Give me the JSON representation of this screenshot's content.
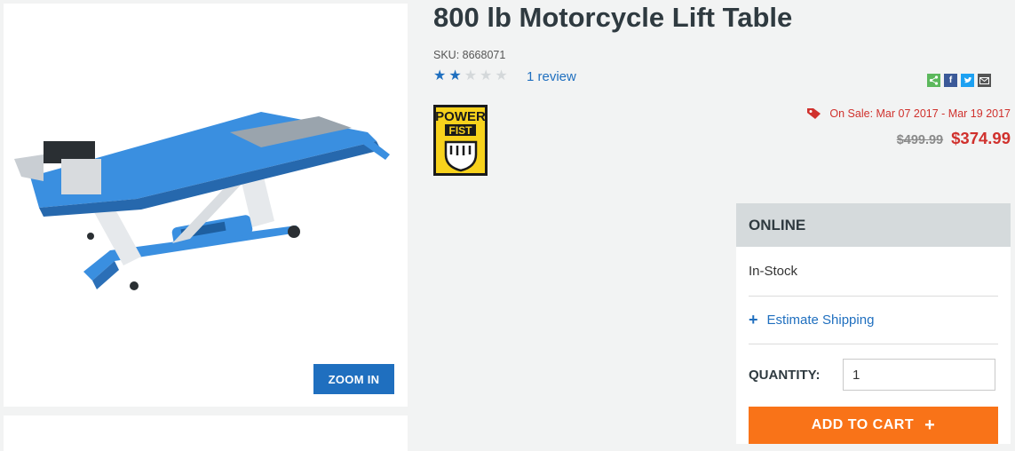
{
  "product": {
    "title": "800 lb Motorcycle Lift Table",
    "sku": "SKU: 8668071",
    "rating": 2,
    "rating_max": 5,
    "review_link": "1 review",
    "brand_logo_text": [
      "POWER",
      "FIST"
    ]
  },
  "gallery": {
    "zoom_label": "ZOOM IN"
  },
  "share": {
    "icons": [
      "share-icon",
      "facebook-icon",
      "twitter-icon",
      "email-icon"
    ],
    "colors": [
      "#5cb85c",
      "#3b5998",
      "#1da1f2",
      "#555555"
    ]
  },
  "pricing": {
    "sale_text": "On Sale: Mar 07 2017 - Mar 19 2017",
    "old_price": "$499.99",
    "new_price": "$374.99"
  },
  "availability": {
    "header": "ONLINE",
    "stock": "In-Stock",
    "estimate_shipping": "Estimate Shipping",
    "quantity_label": "QUANTITY:",
    "quantity_value": "1",
    "add_to_cart": "ADD TO CART"
  },
  "colors": {
    "accent_blue": "#1f6fbf",
    "sale_red": "#d0312d",
    "cart_orange": "#f97318"
  }
}
